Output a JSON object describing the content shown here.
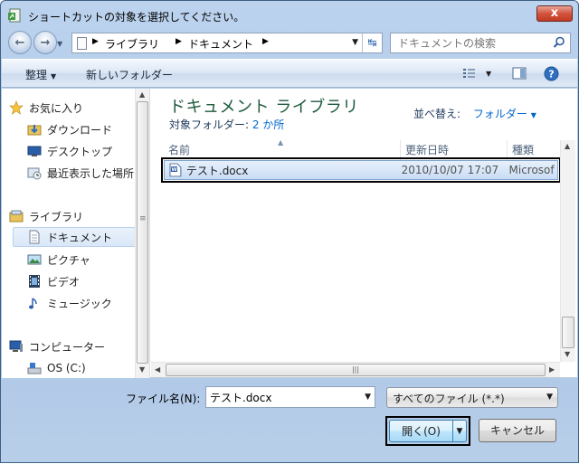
{
  "window": {
    "title": "ショートカットの対象を選択してください。",
    "close_label": "x"
  },
  "nav": {
    "back_label": "←",
    "forward_label": "→",
    "breadcrumbs": [
      "ライブラリ",
      "ドキュメント"
    ],
    "search_placeholder": "ドキュメントの検索"
  },
  "toolbar": {
    "organize_label": "整理",
    "new_folder_label": "新しいフォルダー"
  },
  "sidebar": {
    "items": [
      {
        "label": "お気に入り",
        "icon": "star-icon"
      },
      {
        "label": "ダウンロード",
        "icon": "download-folder-icon"
      },
      {
        "label": "デスクトップ",
        "icon": "desktop-icon"
      },
      {
        "label": "最近表示した場所",
        "icon": "recent-places-icon"
      },
      {
        "label": "ライブラリ",
        "icon": "library-icon"
      },
      {
        "label": "ドキュメント",
        "icon": "document-icon",
        "selected": true
      },
      {
        "label": "ピクチャ",
        "icon": "picture-icon"
      },
      {
        "label": "ビデオ",
        "icon": "video-icon"
      },
      {
        "label": "ミュージック",
        "icon": "music-icon"
      },
      {
        "label": "コンピューター",
        "icon": "computer-icon"
      },
      {
        "label": "OS (C:)",
        "icon": "drive-icon"
      }
    ]
  },
  "main": {
    "library_title": "ドキュメント ライブラリ",
    "target_folder_label": "対象フォルダー:",
    "target_folder_link": "2 か所",
    "arrange_label": "並べ替え:",
    "arrange_value": "フォルダー",
    "columns": [
      "名前",
      "更新日時",
      "種類"
    ],
    "files": [
      {
        "name": "テスト.docx",
        "modified": "2010/10/07 17:07",
        "type": "Microsof"
      }
    ]
  },
  "bottom": {
    "filename_label": "ファイル名(N):",
    "filename_value": "テスト.docx",
    "filter_value": "すべてのファイル (*.*)",
    "open_label": "開く(O)",
    "cancel_label": "キャンセル"
  }
}
